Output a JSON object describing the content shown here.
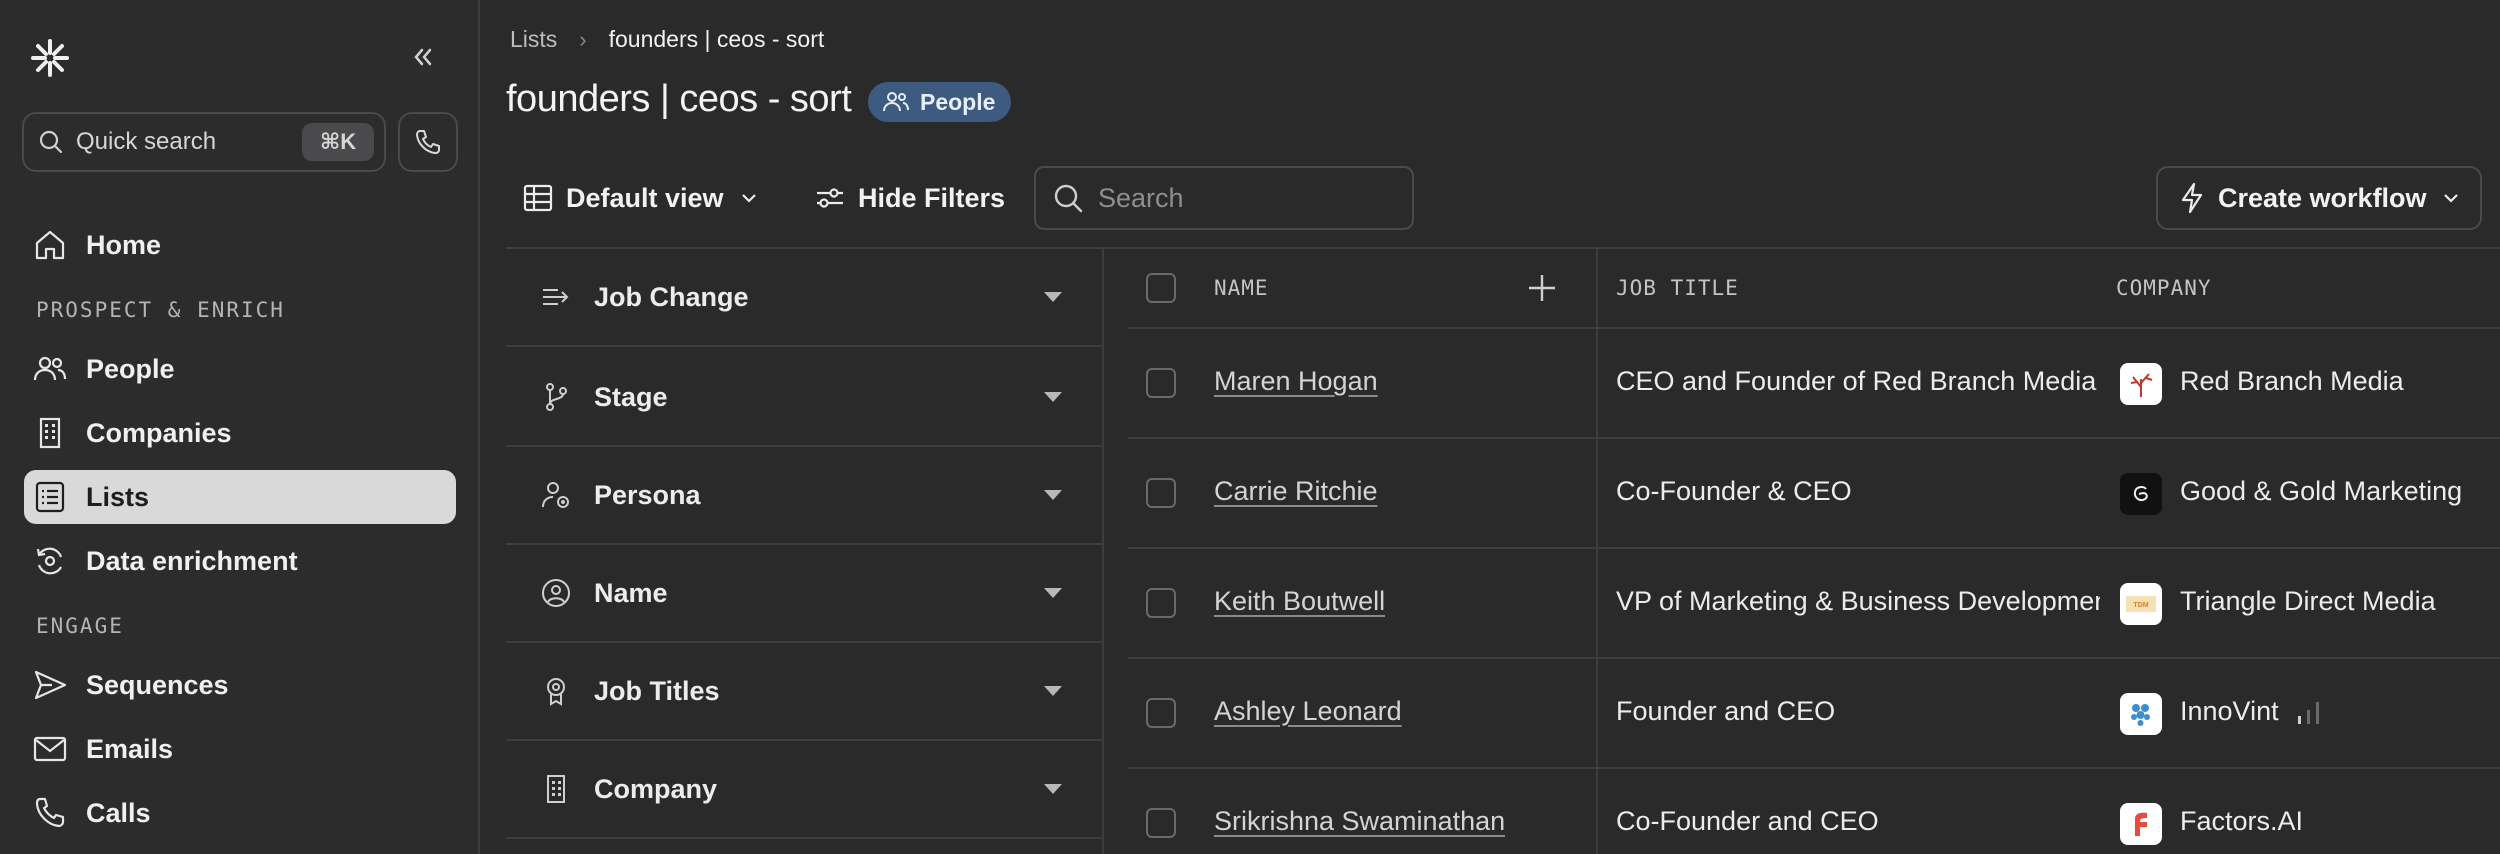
{
  "sidebar": {
    "search_label": "Quick search",
    "search_shortcut": "⌘K",
    "nav": [
      {
        "label": "Home",
        "icon": "home-icon"
      },
      {
        "label": "People",
        "icon": "people-icon"
      },
      {
        "label": "Companies",
        "icon": "building-icon"
      },
      {
        "label": "Lists",
        "icon": "list-icon",
        "active": true
      },
      {
        "label": "Data enrichment",
        "icon": "refresh-icon"
      },
      {
        "label": "Sequences",
        "icon": "send-icon"
      },
      {
        "label": "Emails",
        "icon": "mail-icon"
      },
      {
        "label": "Calls",
        "icon": "phone-icon"
      }
    ],
    "sections": {
      "prospect": "PROSPECT & ENRICH",
      "engage": "ENGAGE"
    }
  },
  "breadcrumb": {
    "parent": "Lists",
    "sep": "›",
    "current": "founders | ceos - sort"
  },
  "page": {
    "title": "founders | ceos - sort",
    "badge": "People"
  },
  "toolbar": {
    "view_label": "Default view",
    "filters_label": "Hide Filters",
    "search_placeholder": "Search",
    "workflow_label": "Create workflow"
  },
  "filters": [
    "Job Change",
    "Stage",
    "Persona",
    "Name",
    "Job Titles",
    "Company"
  ],
  "table": {
    "columns": [
      "NAME",
      "JOB TITLE",
      "COMPANY"
    ],
    "rows": [
      {
        "name": "Maren Hogan",
        "job": "CEO and Founder of Red Branch Media",
        "company": "Red Branch Media",
        "logo_color": "#ffffff"
      },
      {
        "name": "Carrie Ritchie",
        "job": "Co-Founder & CEO",
        "company": "Good & Gold Marketing",
        "logo_color": "#111111"
      },
      {
        "name": "Keith Boutwell",
        "job": "VP of Marketing & Business Development",
        "company": "Triangle Direct Media",
        "logo_color": "#ffffff"
      },
      {
        "name": "Ashley Leonard",
        "job": "Founder and CEO",
        "company": "InnoVint",
        "logo_color": "#ffffff"
      },
      {
        "name": "Srikrishna Swaminathan",
        "job": "Co-Founder and CEO",
        "company": "Factors.AI",
        "logo_color": "#ffffff"
      }
    ]
  },
  "colors": {
    "accent_badge": "#3d5a80",
    "active_nav": "#d9d9d9"
  }
}
